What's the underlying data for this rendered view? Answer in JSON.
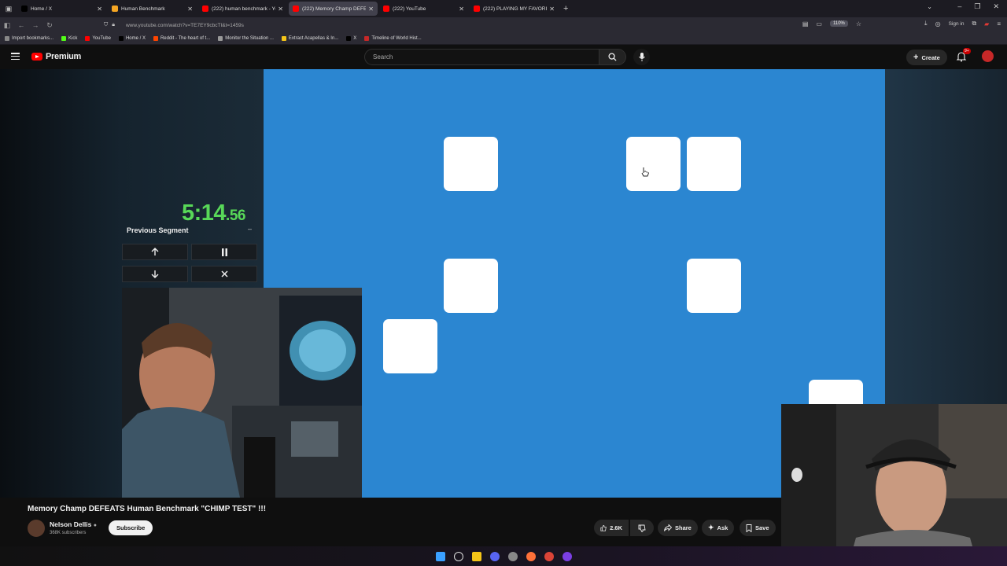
{
  "browser": {
    "tabs": [
      {
        "title": "Home / X",
        "color": "#000000",
        "active": false
      },
      {
        "title": "Human Benchmark",
        "color": "#f5a623",
        "active": false
      },
      {
        "title": "(222) human benchmark - YouT",
        "color": "#ff0000",
        "active": false
      },
      {
        "title": "(222) Memory Champ DEFE",
        "color": "#ff0000",
        "active": true
      },
      {
        "title": "(222) YouTube",
        "color": "#ff0000",
        "active": false
      },
      {
        "title": "(222) PLAYING MY FAVORI",
        "color": "#ff0000",
        "active": false
      }
    ],
    "url": "www.youtube.com/watch?v=TE7EY9cbcTI&t=1459s",
    "zoom": "110%",
    "sign_in": "Sign in",
    "bookmarks": [
      {
        "label": "Import bookmarks...",
        "color": "#888888"
      },
      {
        "label": "Kick",
        "color": "#53fc18"
      },
      {
        "label": "YouTube",
        "color": "#ff0000"
      },
      {
        "label": "Home / X",
        "color": "#000000"
      },
      {
        "label": "Reddit - The heart of t...",
        "color": "#ff4500"
      },
      {
        "label": "Monitor the Situation ...",
        "color": "#999999"
      },
      {
        "label": "Extract Acapellas & In...",
        "color": "#f5c518"
      },
      {
        "label": "X",
        "color": "#000000"
      },
      {
        "label": "Timeline of World Hist...",
        "color": "#c62828"
      }
    ]
  },
  "youtube": {
    "logo_text": "Premium",
    "search_placeholder": "Search",
    "create_label": "Create",
    "notification_badge": "9+"
  },
  "overlay": {
    "timer_main": "5:14",
    "timer_fraction": ".56",
    "segment_label": "Previous Segment",
    "segment_dash": "–",
    "buttons": [
      "up",
      "pause",
      "down",
      "close"
    ]
  },
  "game": {
    "background": "#2b86d1",
    "tile_count": 7
  },
  "video": {
    "title": "Memory Champ DEFEATS Human Benchmark \"CHIMP TEST\" !!!",
    "channel": "Nelson Dellis",
    "subscribers": "368K subscribers",
    "subscribe_label": "Subscribe",
    "likes": "2.6K",
    "share_label": "Share",
    "ask_label": "Ask",
    "save_label": "Save"
  }
}
